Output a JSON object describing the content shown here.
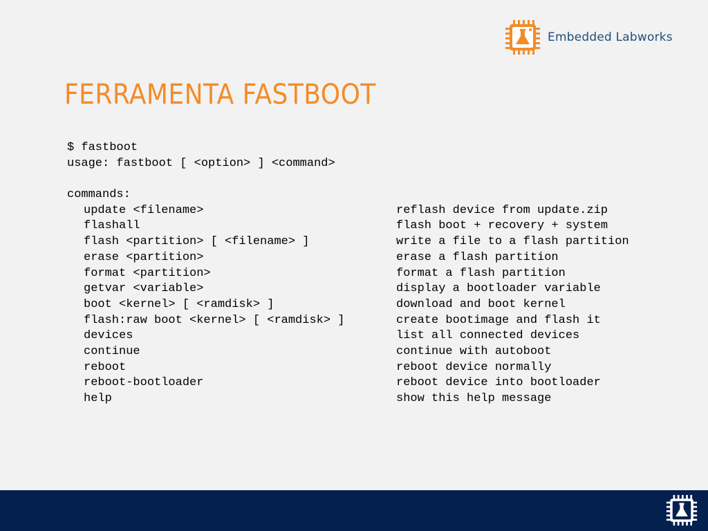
{
  "brand": {
    "name": "Embedded Labworks",
    "logo_icon": "chip-flask-icon",
    "accent_color": "#f28c28",
    "text_color": "#1f4e79",
    "footer_color": "#03204f"
  },
  "slide": {
    "title": "FERRAMENTA FASTBOOT"
  },
  "terminal": {
    "prompt_line": "$ fastboot",
    "usage_line": "usage: fastboot [ <option> ] <command>",
    "commands_header": "commands:",
    "commands": [
      {
        "cmd": "update <filename>",
        "desc": "reflash device from update.zip"
      },
      {
        "cmd": "flashall",
        "desc": "flash boot + recovery + system"
      },
      {
        "cmd": "flash <partition> [ <filename> ]",
        "desc": "write a file to a flash partition"
      },
      {
        "cmd": "erase <partition>",
        "desc": "erase a flash partition"
      },
      {
        "cmd": "format <partition>",
        "desc": "format a flash partition"
      },
      {
        "cmd": "getvar <variable>",
        "desc": "display a bootloader variable"
      },
      {
        "cmd": "boot <kernel> [ <ramdisk> ]",
        "desc": "download and boot kernel"
      },
      {
        "cmd": "flash:raw boot <kernel> [ <ramdisk> ]",
        "desc": "create bootimage and flash it"
      },
      {
        "cmd": "devices",
        "desc": "list all connected devices"
      },
      {
        "cmd": "continue",
        "desc": "continue with autoboot"
      },
      {
        "cmd": "reboot",
        "desc": "reboot device normally"
      },
      {
        "cmd": "reboot-bootloader",
        "desc": "reboot device into bootloader"
      },
      {
        "cmd": "help",
        "desc": "show this help message"
      }
    ]
  }
}
